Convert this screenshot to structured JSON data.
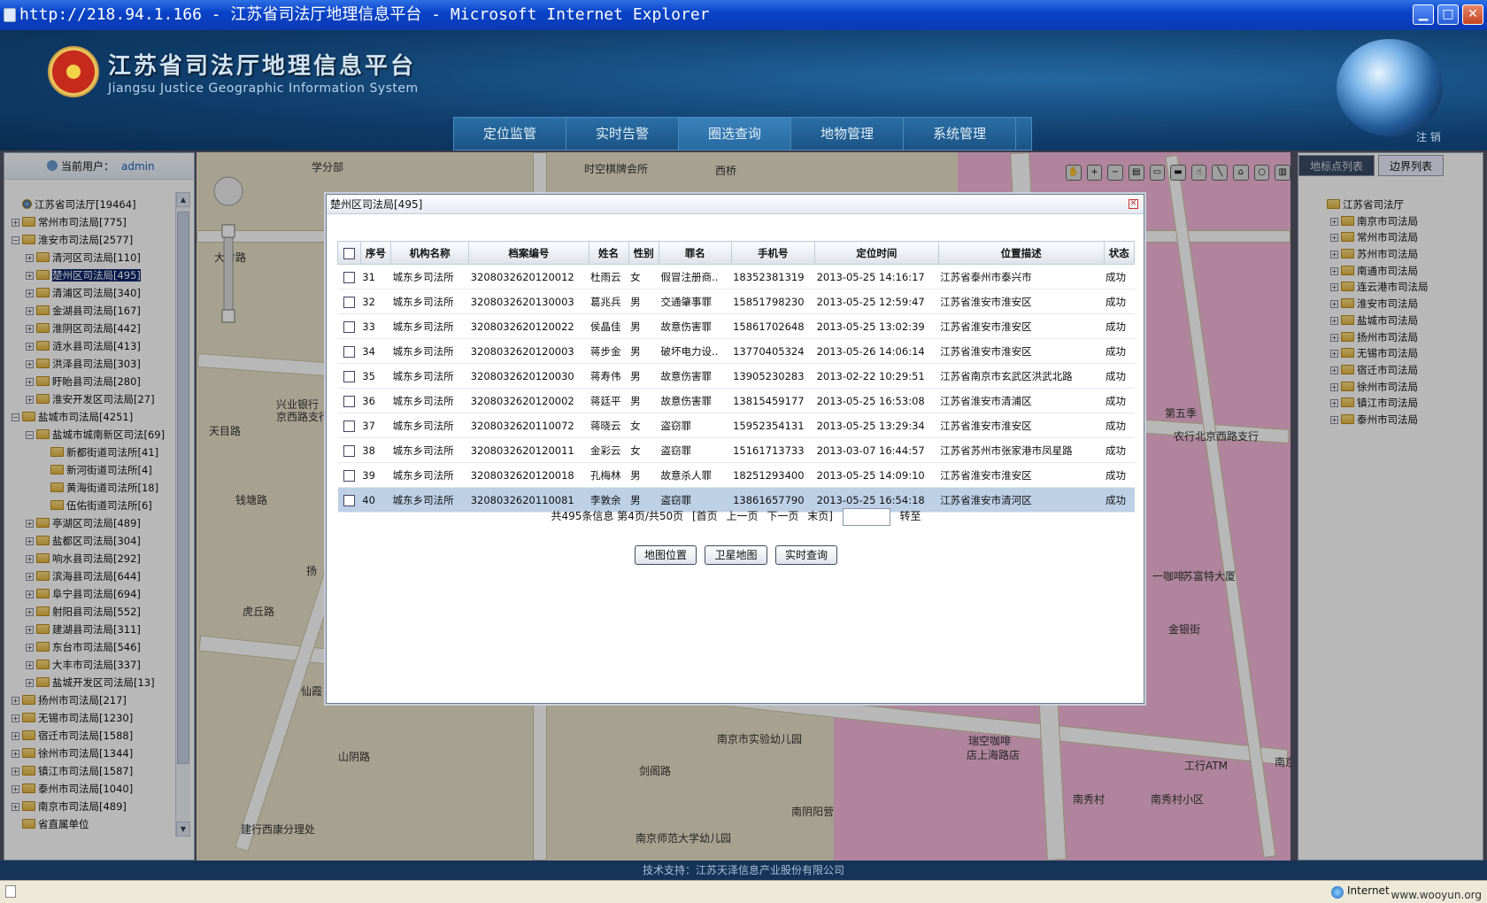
{
  "window": {
    "title": "http://218.94.1.166 - 江苏省司法厅地理信息平台 - Microsoft Internet Explorer",
    "minimize_label": "▁",
    "maximize_label": "□",
    "close_label": "✕"
  },
  "header": {
    "title_cn": "江苏省司法厅地理信息平台",
    "title_en": "Jiangsu Justice Geographic Information System",
    "logout_label": "注 销",
    "nav": [
      "定位监管",
      "实时告警",
      "圈选查询",
      "地物管理",
      "系统管理"
    ],
    "active_nav": "圈选查询"
  },
  "user": {
    "label": "当前用户：",
    "name": "admin"
  },
  "left_tree": [
    {
      "label": "江苏省司法厅[19464]",
      "depth": 0,
      "toggle": "",
      "icon": "globe"
    },
    {
      "label": "常州市司法局[775]",
      "depth": 0,
      "toggle": "+"
    },
    {
      "label": "淮安市司法局[2577]",
      "depth": 0,
      "toggle": "-"
    },
    {
      "label": "清河区司法局[110]",
      "depth": 1,
      "toggle": "+"
    },
    {
      "label": "楚州区司法局[495]",
      "depth": 1,
      "toggle": "+",
      "selected": true
    },
    {
      "label": "清浦区司法局[340]",
      "depth": 1,
      "toggle": "+"
    },
    {
      "label": "金湖县司法局[167]",
      "depth": 1,
      "toggle": "+"
    },
    {
      "label": "淮阴区司法局[442]",
      "depth": 1,
      "toggle": "+"
    },
    {
      "label": "涟水县司法局[413]",
      "depth": 1,
      "toggle": "+"
    },
    {
      "label": "洪泽县司法局[303]",
      "depth": 1,
      "toggle": "+"
    },
    {
      "label": "盱眙县司法局[280]",
      "depth": 1,
      "toggle": "+"
    },
    {
      "label": "淮安开发区司法局[27]",
      "depth": 1,
      "toggle": "+"
    },
    {
      "label": "盐城市司法局[4251]",
      "depth": 0,
      "toggle": "-"
    },
    {
      "label": "盐城市城南新区司法[69]",
      "depth": 1,
      "toggle": "-"
    },
    {
      "label": "新都街道司法所[41]",
      "depth": 2,
      "toggle": ""
    },
    {
      "label": "新河街道司法所[4]",
      "depth": 2,
      "toggle": ""
    },
    {
      "label": "黄海街道司法所[18]",
      "depth": 2,
      "toggle": ""
    },
    {
      "label": "伍佑街道司法所[6]",
      "depth": 2,
      "toggle": ""
    },
    {
      "label": "亭湖区司法局[489]",
      "depth": 1,
      "toggle": "+"
    },
    {
      "label": "盐都区司法局[304]",
      "depth": 1,
      "toggle": "+"
    },
    {
      "label": "响水县司法局[292]",
      "depth": 1,
      "toggle": "+"
    },
    {
      "label": "滨海县司法局[644]",
      "depth": 1,
      "toggle": "+"
    },
    {
      "label": "阜宁县司法局[694]",
      "depth": 1,
      "toggle": "+"
    },
    {
      "label": "射阳县司法局[552]",
      "depth": 1,
      "toggle": "+"
    },
    {
      "label": "建湖县司法局[311]",
      "depth": 1,
      "toggle": "+"
    },
    {
      "label": "东台市司法局[546]",
      "depth": 1,
      "toggle": "+"
    },
    {
      "label": "大丰市司法局[337]",
      "depth": 1,
      "toggle": "+"
    },
    {
      "label": "盐城开发区司法局[13]",
      "depth": 1,
      "toggle": "+"
    },
    {
      "label": "扬州市司法局[217]",
      "depth": 0,
      "toggle": "+"
    },
    {
      "label": "无锡市司法局[1230]",
      "depth": 0,
      "toggle": "+"
    },
    {
      "label": "宿迁市司法局[1588]",
      "depth": 0,
      "toggle": "+"
    },
    {
      "label": "徐州市司法局[1344]",
      "depth": 0,
      "toggle": "+"
    },
    {
      "label": "镇江市司法局[1587]",
      "depth": 0,
      "toggle": "+"
    },
    {
      "label": "泰州市司法局[1040]",
      "depth": 0,
      "toggle": "+"
    },
    {
      "label": "南京市司法局[489]",
      "depth": 0,
      "toggle": "+"
    },
    {
      "label": "省直属单位",
      "depth": 0,
      "toggle": ""
    }
  ],
  "right_panel": {
    "tabs": [
      "地标点列表",
      "边界列表"
    ],
    "tree": [
      {
        "label": "江苏省司法厅",
        "depth": 0,
        "toggle": ""
      },
      {
        "label": "南京市司法局",
        "depth": 1,
        "toggle": "+"
      },
      {
        "label": "常州市司法局",
        "depth": 1,
        "toggle": "+"
      },
      {
        "label": "苏州市司法局",
        "depth": 1,
        "toggle": "+"
      },
      {
        "label": "南通市司法局",
        "depth": 1,
        "toggle": "+"
      },
      {
        "label": "连云港市司法局",
        "depth": 1,
        "toggle": "+"
      },
      {
        "label": "淮安市司法局",
        "depth": 1,
        "toggle": "+"
      },
      {
        "label": "盐城市司法局",
        "depth": 1,
        "toggle": "+"
      },
      {
        "label": "扬州市司法局",
        "depth": 1,
        "toggle": "+"
      },
      {
        "label": "无锡市司法局",
        "depth": 1,
        "toggle": "+"
      },
      {
        "label": "宿迁市司法局",
        "depth": 1,
        "toggle": "+"
      },
      {
        "label": "徐州市司法局",
        "depth": 1,
        "toggle": "+"
      },
      {
        "label": "镇江市司法局",
        "depth": 1,
        "toggle": "+"
      },
      {
        "label": "泰州市司法局",
        "depth": 1,
        "toggle": "+"
      }
    ]
  },
  "map_labels": [
    "学分部",
    "时空棋牌会所",
    "西桥",
    "大竹路",
    "兴业银行",
    "京西路支行",
    "天目路",
    "钱塘路",
    "扬",
    "虎丘路",
    "仙霞",
    "山阴路",
    "剑阁路",
    "南京市实验幼儿园",
    "南阴阳营",
    "南京师范大学幼儿园",
    "建行西康分理处",
    "第五季",
    "农行北京西路支行",
    "一咖啡",
    "苏富特大厦",
    "金银街",
    "瑞空咖啡",
    "店上海路店",
    "工行ATM",
    "南秀村",
    "南秀村小区",
    "南京"
  ],
  "dialog": {
    "title": "楚州区司法局[495]",
    "close_label": "✕",
    "columns": [
      "序号",
      "机构名称",
      "档案编号",
      "姓名",
      "性别",
      "罪名",
      "手机号",
      "定位时间",
      "位置描述",
      "状态"
    ],
    "rows": [
      [
        "31",
        "城东乡司法所",
        "3208032620120012",
        "杜雨云",
        "女",
        "假冒注册商..",
        "18352381319",
        "2013-05-25 14:16:17",
        "江苏省泰州市泰兴市",
        "成功"
      ],
      [
        "32",
        "城东乡司法所",
        "3208032620130003",
        "葛兆兵",
        "男",
        "交通肇事罪",
        "15851798230",
        "2013-05-25 12:59:47",
        "江苏省淮安市淮安区",
        "成功"
      ],
      [
        "33",
        "城东乡司法所",
        "3208032620120022",
        "侯晶佳",
        "男",
        "故意伤害罪",
        "15861702648",
        "2013-05-25 13:02:39",
        "江苏省淮安市淮安区",
        "成功"
      ],
      [
        "34",
        "城东乡司法所",
        "3208032620120003",
        "蒋步金",
        "男",
        "破坏电力设..",
        "13770405324",
        "2013-05-26 14:06:14",
        "江苏省淮安市淮安区",
        "成功"
      ],
      [
        "35",
        "城东乡司法所",
        "3208032620120030",
        "蒋寿伟",
        "男",
        "故意伤害罪",
        "13905230283",
        "2013-02-22 10:29:51",
        "江苏省南京市玄武区洪武北路",
        "成功"
      ],
      [
        "36",
        "城东乡司法所",
        "3208032620120002",
        "蒋廷平",
        "男",
        "故意伤害罪",
        "13815459177",
        "2013-05-25 16:53:08",
        "江苏省淮安市清浦区",
        "成功"
      ],
      [
        "37",
        "城东乡司法所",
        "3208032620110072",
        "蒋晓云",
        "女",
        "盗窃罪",
        "15952354131",
        "2013-05-25 13:29:34",
        "江苏省淮安市淮安区",
        "成功"
      ],
      [
        "38",
        "城东乡司法所",
        "3208032620120011",
        "金彩云",
        "女",
        "盗窃罪",
        "15161713733",
        "2013-03-07 16:44:57",
        "江苏省苏州市张家港市凤星路",
        "成功"
      ],
      [
        "39",
        "城东乡司法所",
        "3208032620120018",
        "孔梅林",
        "男",
        "故意杀人罪",
        "18251293400",
        "2013-05-25 14:09:10",
        "江苏省淮安市淮安区",
        "成功"
      ],
      [
        "40",
        "城东乡司法所",
        "3208032620110081",
        "李敦余",
        "男",
        "盗窃罪",
        "13861657790",
        "2013-05-25 16:54:18",
        "江苏省淮安市清河区",
        "成功"
      ]
    ],
    "highlighted_row": "40",
    "pager": {
      "summary_prefix": "共",
      "total": "495",
      "summary_mid": "条信息 第",
      "page": "4",
      "summary_mid2": "页/共",
      "pages": "50",
      "summary_suffix": "页",
      "first": "[首页",
      "prev": "上一页",
      "next": "下一页",
      "last": "末页]",
      "goto_value": "",
      "goto_label": "转至"
    },
    "buttons": [
      "地图位置",
      "卫星地图",
      "实时查询"
    ]
  },
  "footer": {
    "text": "技术支持：江苏天泽信息产业股份有限公司"
  },
  "statusbar": {
    "zone": "Internet",
    "watermark": "www.wooyun.org"
  },
  "colors": {
    "header_bg": "#0f3c6a",
    "selected_row": "#bdd0e6",
    "tree_selected": "#0a246a",
    "map_pink": "#f3b8d8"
  }
}
